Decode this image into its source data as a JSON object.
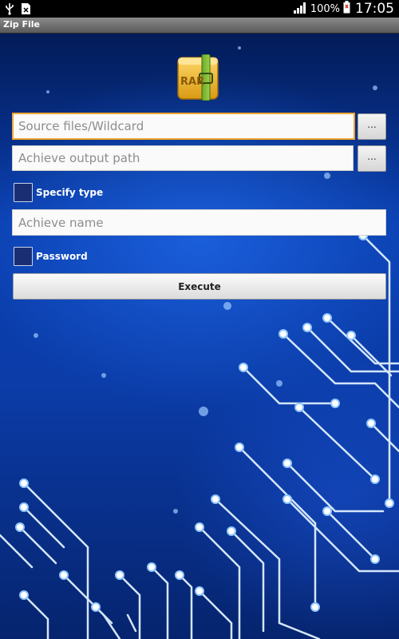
{
  "status_bar": {
    "battery": "100%",
    "time": "17:05"
  },
  "app": {
    "title": "Zip File",
    "logo_text": "RAR"
  },
  "form": {
    "source_placeholder": "Source files/Wildcard",
    "output_placeholder": "Achieve output path",
    "browse_label": "...",
    "specify_type_label": "Specify type",
    "achieve_name_placeholder": "Achieve name",
    "password_label": "Password",
    "execute_label": "Execute"
  },
  "colors": {
    "focus_border": "#f2a531",
    "background_blue": "#0a3fb0"
  }
}
